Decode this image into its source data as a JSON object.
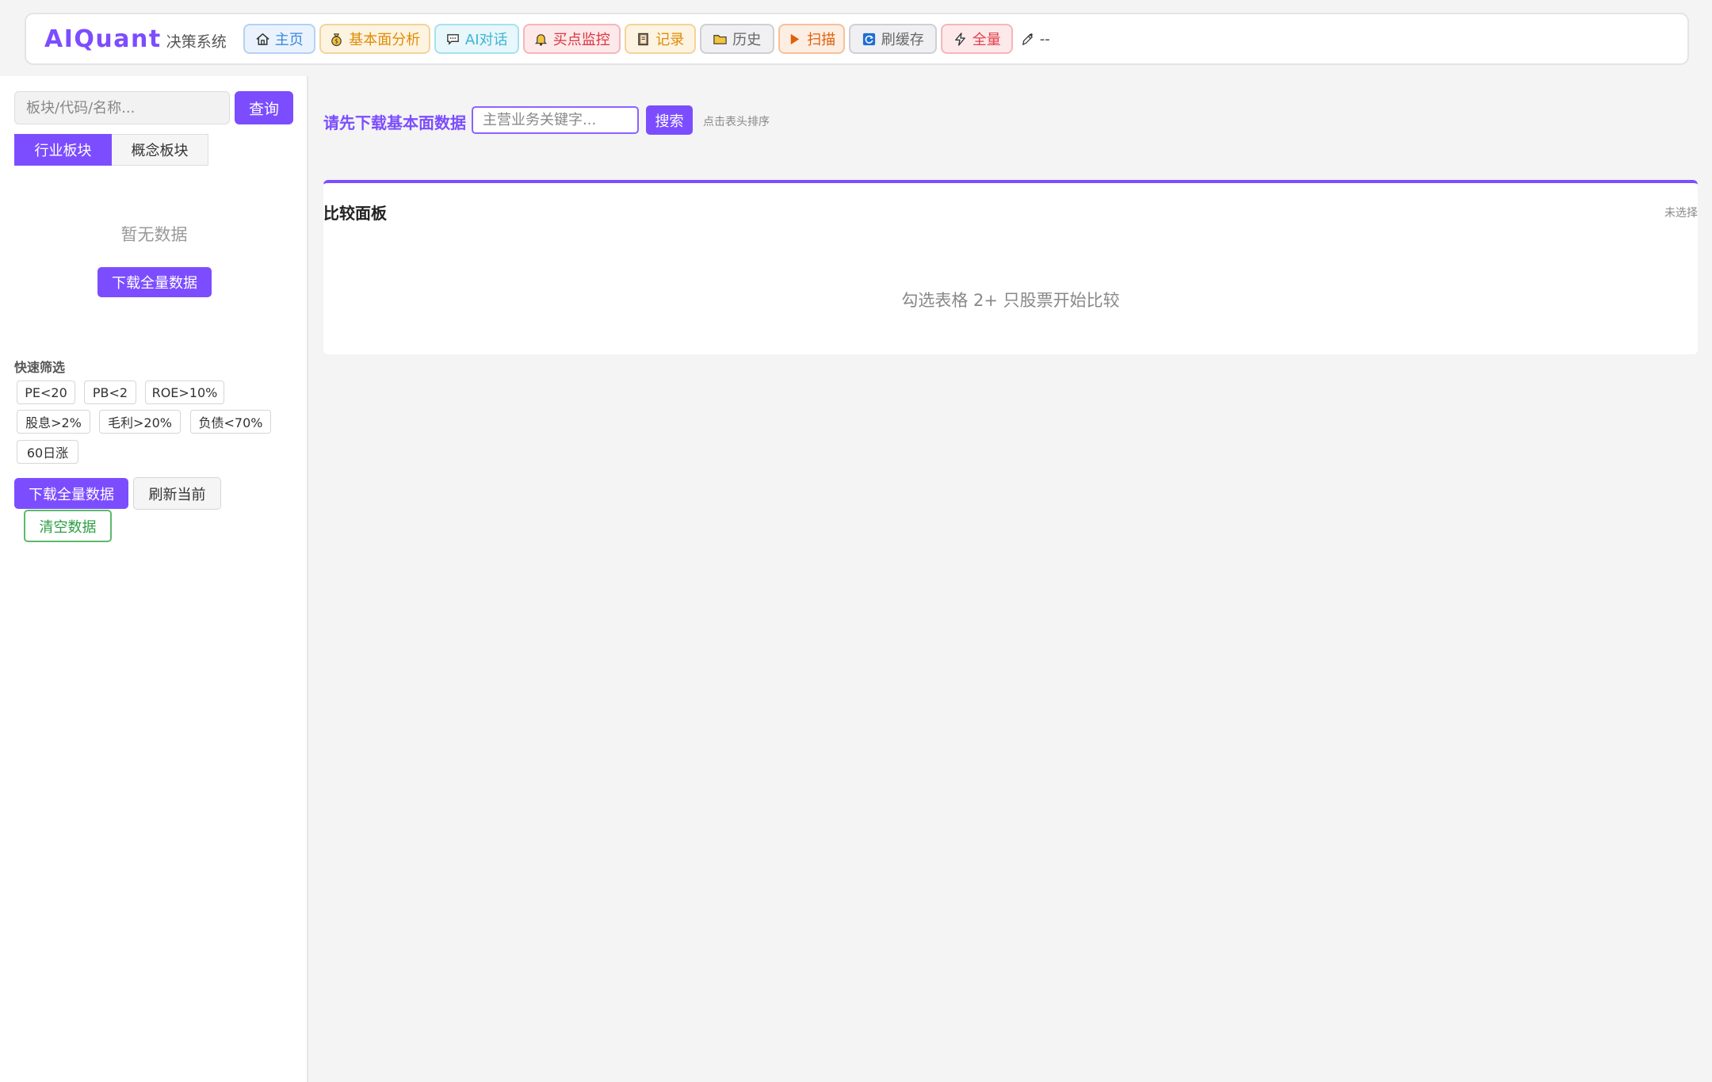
{
  "brand": {
    "name": "AIQuant",
    "subtitle": "决策系统"
  },
  "nav": {
    "home": "主页",
    "fundamental": "基本面分析",
    "ai_chat": "AI对话",
    "buy_monitor": "买点监控",
    "records": "记录",
    "history": "历史",
    "scan": "扫描",
    "refresh_cache": "刷缓存",
    "full": "全量",
    "status_text": "--"
  },
  "sidebar": {
    "search_placeholder": "板块/代码/名称...",
    "query_label": "查询",
    "tabs": [
      "行业板块",
      "概念板块"
    ],
    "active_tab_index": 0,
    "empty_text": "暂无数据",
    "download_label": "下载全量数据",
    "quick_filter_title": "快速筛选",
    "quick_filters": [
      "PE<20",
      "PB<2",
      "ROE>10%",
      "股息>2%",
      "毛利>20%",
      "负债<70%",
      "60日涨"
    ],
    "download_all_label": "下载全量数据",
    "refresh_current_label": "刷新当前",
    "clear_data_label": "清空数据"
  },
  "main": {
    "title": "请先下载基本面数据",
    "keyword_placeholder": "主营业务关键字...",
    "search_label": "搜索",
    "sort_hint": "点击表头排序"
  },
  "compare": {
    "title": "比较面板",
    "state": "未选择",
    "hint": "勾选表格 2+ 只股票开始比较"
  },
  "colors": {
    "accent": "#7c4dff",
    "clear_green": "#2e9e44"
  },
  "icons": {
    "home": "home-icon",
    "fundamental": "money-bag-icon",
    "ai_chat": "chat-bubble-icon",
    "buy_monitor": "bell-icon",
    "records": "notebook-icon",
    "history": "folder-icon",
    "scan": "play-icon",
    "refresh_cache": "refresh-icon",
    "full": "lightning-icon",
    "status": "pen-icon"
  }
}
